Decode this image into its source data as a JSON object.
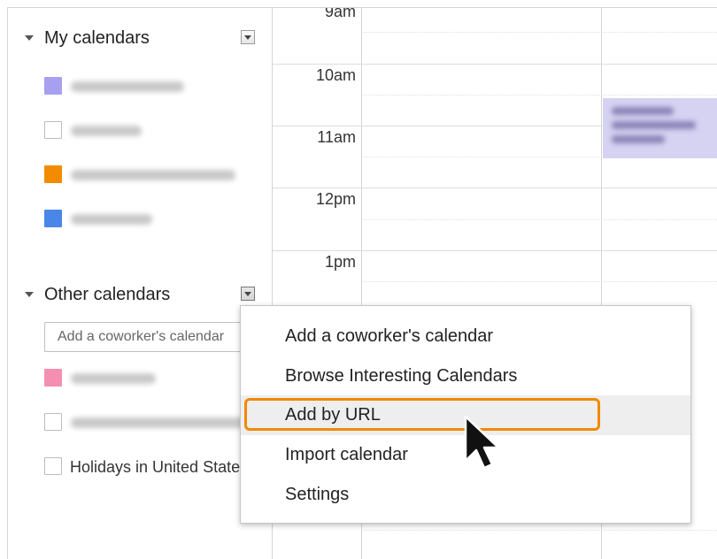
{
  "sidebar": {
    "my_calendars": {
      "title": "My calendars",
      "items": [
        {
          "color": "#a7a0f0",
          "label_blurred": true
        },
        {
          "color": null,
          "label_blurred": true
        },
        {
          "color": "#f28b00",
          "label_blurred": true
        },
        {
          "color": "#4a86e8",
          "label_blurred": true
        }
      ]
    },
    "other_calendars": {
      "title": "Other calendars",
      "coworker_placeholder": "Add a coworker's calendar",
      "items": [
        {
          "color": "#f48fb1",
          "label_blurred": true
        },
        {
          "color": null,
          "label_blurred": true
        },
        {
          "color": null,
          "label": "Holidays in United States"
        }
      ]
    }
  },
  "grid": {
    "hours": [
      "9am",
      "10am",
      "11am",
      "12pm",
      "1pm"
    ]
  },
  "dropdown": {
    "items": [
      "Add a coworker's calendar",
      "Browse Interesting Calendars",
      "Add by URL",
      "Import calendar",
      "Settings"
    ],
    "highlighted_item": "Add by URL",
    "highlight_color": "#f08a00"
  }
}
